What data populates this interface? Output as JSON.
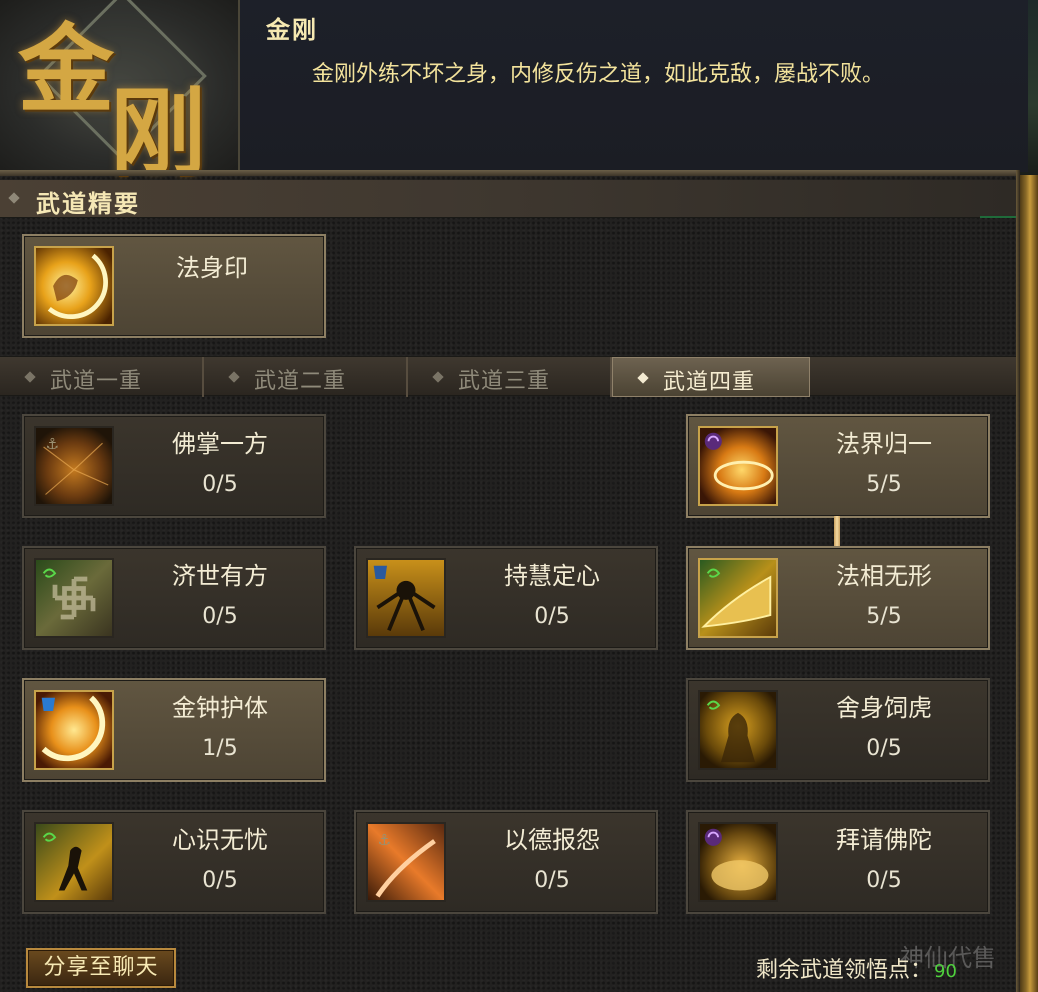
{
  "header": {
    "emblem_chars": [
      "金",
      "刚"
    ],
    "title": "金刚",
    "description": "金刚外练不坏之身，内修反伤之道，如此克敌，屡战不败。"
  },
  "section": {
    "label": "武道精要"
  },
  "core_skill": {
    "name": "法身印"
  },
  "tabs": [
    {
      "label": "武道一重",
      "active": false
    },
    {
      "label": "武道二重",
      "active": false
    },
    {
      "label": "武道三重",
      "active": false
    },
    {
      "label": "武道四重",
      "active": true
    }
  ],
  "skills": [
    {
      "name": "佛掌一方",
      "level": "0/5",
      "icon": "flame-palm-icon"
    },
    {
      "name": "法界归一",
      "level": "5/5",
      "icon": "golden-wheel-icon"
    },
    {
      "name": "济世有方",
      "level": "0/5",
      "icon": "swastika-icon"
    },
    {
      "name": "持慧定心",
      "level": "0/5",
      "icon": "spider-icon"
    },
    {
      "name": "法相无形",
      "level": "5/5",
      "icon": "golden-shoe-icon"
    },
    {
      "name": "金钟护体",
      "level": "1/5",
      "icon": "golden-shield-icon"
    },
    {
      "name": "舍身饲虎",
      "level": "0/5",
      "icon": "monk-icon"
    },
    {
      "name": "心识无忧",
      "level": "0/5",
      "icon": "figure-icon"
    },
    {
      "name": "以德报怨",
      "level": "0/5",
      "icon": "fire-slash-icon"
    },
    {
      "name": "拜请佛陀",
      "level": "0/5",
      "icon": "buddha-hand-icon"
    }
  ],
  "footer": {
    "share_label": "分享至聊天",
    "points_label": "剩余武道领悟点：",
    "points_value": "90",
    "watermark": "神仙代售"
  },
  "colors": {
    "gold": "#d4a743",
    "points_green": "#4fd13d",
    "active_border": "#c7a24a"
  }
}
